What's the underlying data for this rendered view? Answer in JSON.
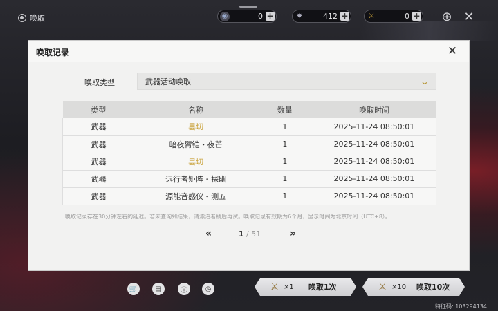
{
  "header": {
    "back_label": "唤取",
    "currencies": [
      {
        "icon": "jade-icon",
        "value": "0",
        "plus": "+"
      },
      {
        "icon": "star-icon",
        "value": "412",
        "plus": "+"
      },
      {
        "icon": "sword-icon",
        "value": "0",
        "plus": "+"
      }
    ]
  },
  "modal": {
    "title": "唤取记录",
    "filter_label": "唤取类型",
    "filter_value": "武器活动唤取",
    "table": {
      "headers": [
        "类型",
        "名称",
        "数量",
        "唤取时间"
      ],
      "rows": [
        {
          "type": "武器",
          "name": "昙切",
          "qty": "1",
          "time": "2025-11-24 08:50:01",
          "highlight": true
        },
        {
          "type": "武器",
          "name": "暗夜臂铠・夜芒",
          "qty": "1",
          "time": "2025-11-24 08:50:01",
          "highlight": false
        },
        {
          "type": "武器",
          "name": "昙切",
          "qty": "1",
          "time": "2025-11-24 08:50:01",
          "highlight": true
        },
        {
          "type": "武器",
          "name": "远行者矩阵・探幽",
          "qty": "1",
          "time": "2025-11-24 08:50:01",
          "highlight": false
        },
        {
          "type": "武器",
          "name": "源能音感仪・测五",
          "qty": "1",
          "time": "2025-11-24 08:50:01",
          "highlight": false
        }
      ]
    },
    "notice": "唤取记录存在30分钟左右的延迟。若未查询到结果，请漂泊者稍后再试。唤取记录有效期为6个月，显示时间为北京时间（UTC+8）。",
    "pager": {
      "prev": "«",
      "current": "1",
      "total": "/ 51",
      "next": "»"
    }
  },
  "footer": {
    "pull_one_mult": "×1",
    "pull_one_label": "唤取1次",
    "pull_ten_mult": "×10",
    "pull_ten_label": "唤取10次",
    "uid": "特征码: 103294134"
  },
  "colors": {
    "accent_gold": "#c9a23a",
    "modal_bg": "#f2f2f1"
  }
}
